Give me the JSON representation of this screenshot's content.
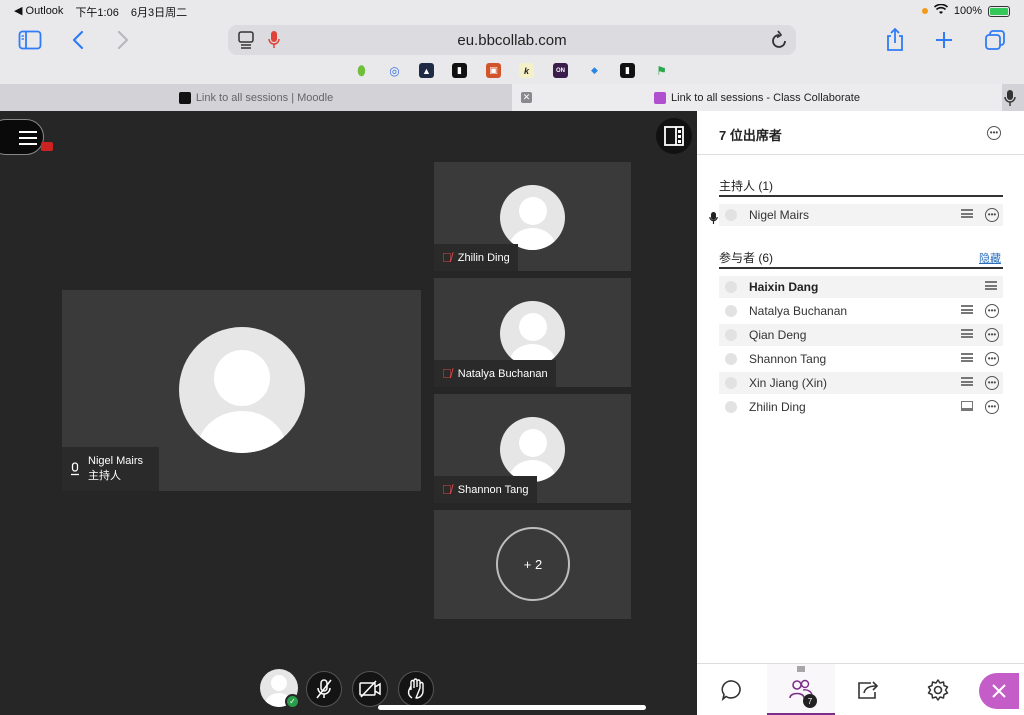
{
  "status": {
    "back_app": "◀ Outlook",
    "time": "下午1:06",
    "date": "6月3日周二",
    "battery": "100%"
  },
  "browser": {
    "url": "eu.bbcollab.com",
    "tabs": [
      {
        "label": "Link to all sessions | Moodle"
      },
      {
        "label": "Link to all sessions - Class Collaborate"
      }
    ]
  },
  "stage": {
    "main_speaker": {
      "name": "Nigel Mairs",
      "role": "主持人"
    },
    "tiles": [
      {
        "name": "Zhilin Ding"
      },
      {
        "name": "Natalya Buchanan"
      },
      {
        "name": "Shannon Tang"
      }
    ],
    "overflow": "+ 2"
  },
  "panel": {
    "title": "7 位出席者",
    "hosts_title": "主持人 (1)",
    "participants_title": "参与者 (6)",
    "hide_label": "隐藏",
    "hosts": [
      {
        "name": "Nigel Mairs"
      }
    ],
    "participants": [
      {
        "name": "Haixin Dang"
      },
      {
        "name": "Natalya Buchanan"
      },
      {
        "name": "Qian Deng"
      },
      {
        "name": "Shannon Tang"
      },
      {
        "name": "Xin Jiang (Xin)"
      },
      {
        "name": "Zhilin Ding"
      }
    ],
    "attendee_badge": "7"
  },
  "colors": {
    "accent": "#7b2e88",
    "close_button": "#c45dc8",
    "safari_blue": "#2f7cf6",
    "stage_bg": "#262626",
    "muted_red": "#e04848"
  }
}
